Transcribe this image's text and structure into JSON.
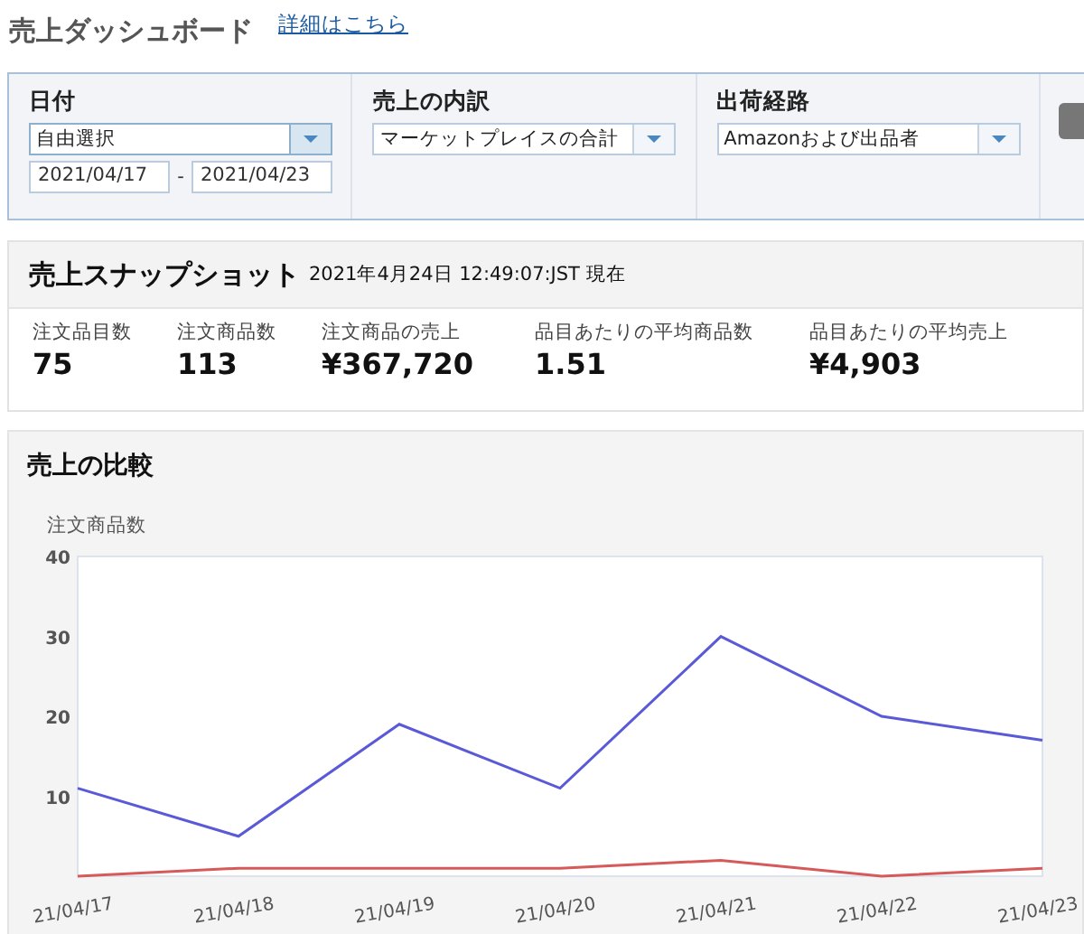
{
  "header": {
    "title": "売上ダッシュボード",
    "link": "詳細はこちら"
  },
  "filters": [
    {
      "label": "日付",
      "select": "自由選択",
      "date_from": "2021/04/17",
      "separator": "-",
      "date_to": "2021/04/23"
    },
    {
      "label": "売上の内訳",
      "select": "マーケットプレイスの合計"
    },
    {
      "label": "出荷経路",
      "select": "Amazonおよび出品者"
    }
  ],
  "snapshot": {
    "title": "売上スナップショット",
    "timestamp": "2021年4月24日 12:49:07:JST 現在",
    "metrics": [
      {
        "label": "注文品目数",
        "value": "75"
      },
      {
        "label": "注文商品数",
        "value": "113"
      },
      {
        "label": "注文商品の売上",
        "value": "¥367,720"
      },
      {
        "label": "品目あたりの平均商品数",
        "value": "1.51"
      },
      {
        "label": "品目あたりの平均売上",
        "value": "¥4,903"
      }
    ]
  },
  "comparison": {
    "title": "売上の比較",
    "chart_data": {
      "type": "line",
      "ylabel": "注文商品数",
      "categories": [
        "21/04/17",
        "21/04/18",
        "21/04/19",
        "21/04/20",
        "21/04/21",
        "21/04/22",
        "21/04/23"
      ],
      "ylim": [
        0,
        40
      ],
      "yticks": [
        10,
        20,
        30,
        40
      ],
      "series": [
        {
          "color": "#5a5ad8",
          "values": [
            11,
            5,
            19,
            11,
            30,
            20,
            17
          ]
        },
        {
          "color": "#d65a5a",
          "values": [
            0,
            1,
            1,
            1,
            2,
            0,
            1
          ]
        }
      ]
    }
  }
}
